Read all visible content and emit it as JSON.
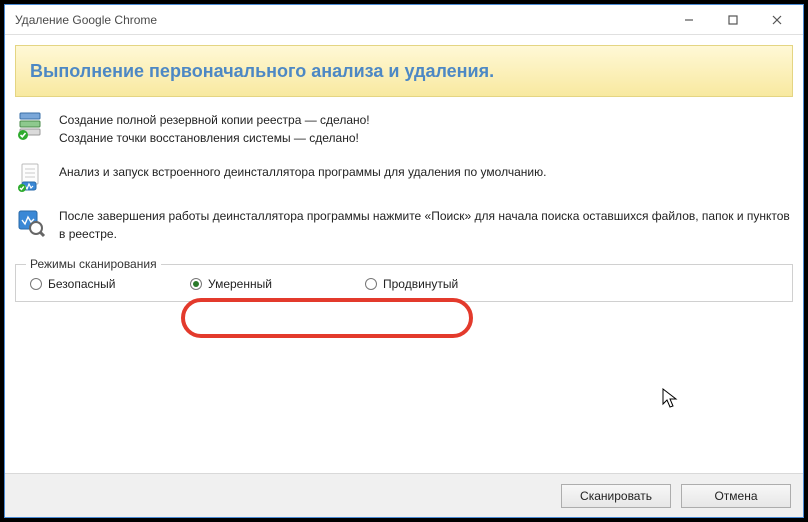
{
  "window": {
    "title": "Удаление Google Chrome"
  },
  "header": {
    "title": "Выполнение первоначального анализа и удаления."
  },
  "steps": {
    "backup_registry": "Создание полной резервной копии реестра — сделано!",
    "restore_point": "Создание точки восстановления системы — сделано!",
    "analyze": "Анализ и запуск встроенного деинсталлятора программы для удаления по умолчанию.",
    "after_uninstall": "После завершения работы деинсталлятора программы нажмите «Поиск» для начала поиска оставшихся файлов, папок и пунктов в реестре."
  },
  "scan": {
    "legend": "Режимы сканирования",
    "options": {
      "safe": {
        "label": "Безопасный",
        "selected": false
      },
      "moderate": {
        "label": "Умеренный",
        "selected": true
      },
      "advanced": {
        "label": "Продвинутый",
        "selected": false
      }
    }
  },
  "footer": {
    "scan": "Сканировать",
    "cancel": "Отмена"
  }
}
